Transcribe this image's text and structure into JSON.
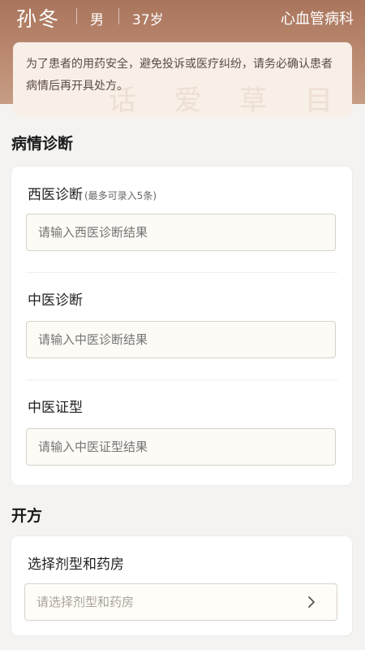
{
  "patient": {
    "name": "孙冬",
    "gender": "男",
    "age": "37岁",
    "department": "心血管病科"
  },
  "notice": {
    "text": "为了患者的用药安全，避免投诉或医疗纠纷，请务必确认患者病情后再开具处方。",
    "watermark": "话 爱 草 目"
  },
  "diagnosis": {
    "title": "病情诊断",
    "western": {
      "label": "西医诊断",
      "note": "(最多可录入5条)",
      "placeholder": "请输入西医诊断结果"
    },
    "tcm": {
      "label": "中医诊断",
      "placeholder": "请输入中医诊断结果"
    },
    "syndrome": {
      "label": "中医证型",
      "placeholder": "请输入中医证型结果"
    }
  },
  "prescription": {
    "title": "开方",
    "dosage_label": "选择剂型和药房",
    "dosage_placeholder": "请选择剂型和药房"
  }
}
